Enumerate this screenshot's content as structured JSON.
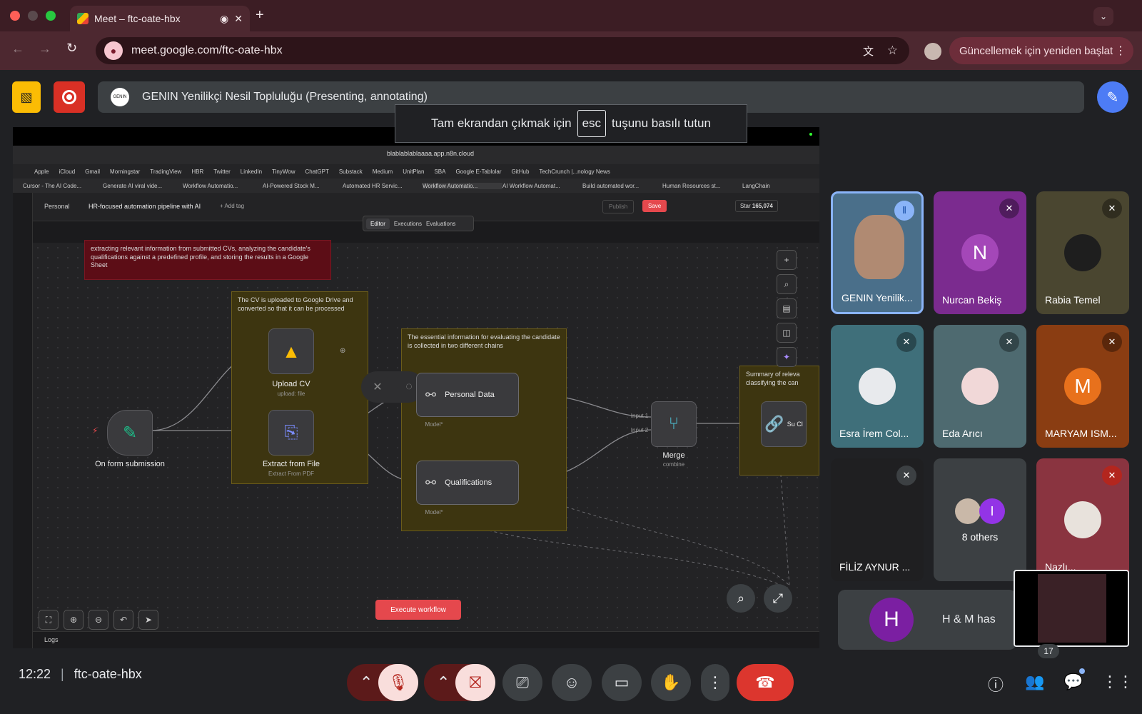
{
  "browser": {
    "tab_title": "Meet – ftc-oate-hbx",
    "url": "meet.google.com/ftc-oate-hbx",
    "update_label": "Güncellemek için yeniden başlat"
  },
  "presentation": {
    "presenter_bar": "GENIN Yenilikçi Nesil Topluluğu (Presenting, annotating)",
    "esc_prefix": "Tam ekrandan çıkmak için",
    "esc_key": "esc",
    "esc_suffix": "tuşunu basılı tutun"
  },
  "shared": {
    "url": "blablablablaaaa.app.n8n.cloud",
    "bookmarks": [
      "Apple",
      "iCloud",
      "Gmail",
      "Morningstar",
      "TradingView",
      "HBR",
      "Twitter",
      "LinkedIn",
      "TinyWow",
      "ChatGPT",
      "Substack",
      "Medium",
      "UnitPlan",
      "SBA",
      "Google E-Tablolar",
      "GitHub",
      "TechCrunch |...nology News"
    ],
    "tabs": [
      "Cursor - The AI Code...",
      "Generate AI viral vide...",
      "Workflow Automatio...",
      "AI-Powered Stock M...",
      "Automated HR Servic...",
      "Workflow Automatio...",
      "AI Workflow Automat...",
      "Build automated wor...",
      "Human Resources st...",
      "LangChain"
    ],
    "breadcrumb_personal": "Personal",
    "breadcrumb_title": "HR-focused automation pipeline with AI",
    "add_tag": "+ Add tag",
    "publish": "Publish",
    "save": "Save",
    "star": "Star",
    "star_count": "165,074",
    "mode_tabs": [
      "Editor",
      "Executions",
      "Evaluations"
    ],
    "sticky_top": "extracting relevant information from submitted CVs, analyzing the candidate's qualifications against a predefined profile, and storing the results in a Google Sheet",
    "sticky_cv": "The CV is uploaded to Google Drive and converted so that it can be processed",
    "sticky_info": "The essential information for evaluating the candidate is collected in two different chains",
    "sticky_summary": "Summary of releva classifying the can",
    "nodes": {
      "form": "On form submission",
      "upload": "Upload CV",
      "upload_sub": "upload: file",
      "extract": "Extract from File",
      "extract_sub": "Extract From PDF",
      "personal": "Personal Data",
      "qual": "Qualifications",
      "merge": "Merge",
      "merge_sub": "combine",
      "model": "Model*",
      "input1": "Input 1",
      "input2": "Input 2",
      "su": "Su Cl"
    },
    "execute": "Execute workflow",
    "logs": "Logs"
  },
  "participants": [
    {
      "name": "GENIN Yenilik...",
      "color": "#4a6f8a"
    },
    {
      "name": "Nurcan Bekiş",
      "initial": "N",
      "color": "#7b2b8f",
      "avatar": "#a447b8"
    },
    {
      "name": "Rabia Temel",
      "color": "#4a4630"
    },
    {
      "name": "Esra İrem Col...",
      "color": "#3f6f7a"
    },
    {
      "name": "Eda Arıcı",
      "color": "#4e6a70"
    },
    {
      "name": "MARYAM ISM...",
      "initial": "M",
      "color": "#8a3d12",
      "avatar": "#e8711c"
    },
    {
      "name": "FİLİZ AYNUR ...",
      "color": "#1f1f21"
    },
    {
      "name": "8 others",
      "color": "#3c4043"
    },
    {
      "name": "Nazlı...",
      "color": "#8a3440"
    }
  ],
  "hm": {
    "initial": "H",
    "name": "H & M has"
  },
  "footer": {
    "time": "12:22",
    "meeting_code": "ftc-oate-hbx",
    "people_count": "17"
  }
}
